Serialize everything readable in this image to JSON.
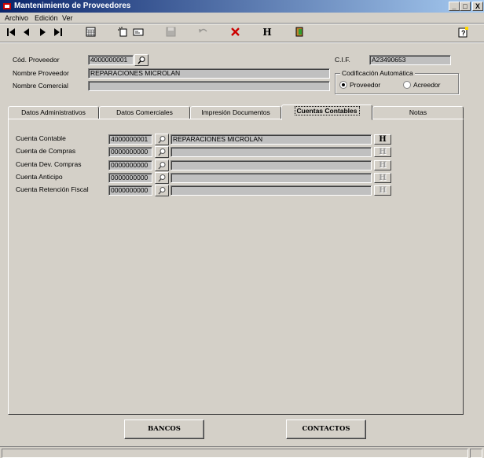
{
  "window": {
    "title": "Mantenimiento de Proveedores",
    "minimize": "_",
    "maximize": "□",
    "close": "X"
  },
  "menu": [
    "Archivo",
    "Edición",
    "Ver"
  ],
  "toolbar": {
    "icons": [
      "first-record-icon",
      "previous-record-icon",
      "next-record-icon",
      "last-record-icon",
      "calculator-icon",
      "new-record-icon",
      "id-card-icon",
      "save-icon",
      "undo-icon",
      "delete-icon",
      "history-icon",
      "exit-icon",
      "help-icon"
    ],
    "h_label": "H",
    "delete_color": "#cc0000"
  },
  "header": {
    "cod_label": "Cód. Proveedor",
    "cod_value": "4000000001",
    "nombre_label": "Nombre Proveedor",
    "nombre_value": "REPARACIONES MICROLAN",
    "comercial_label": "Nombre Comercial",
    "comercial_value": "",
    "cif_label": "C.I.F.",
    "cif_value": "A23490653"
  },
  "codificacion": {
    "title": "Codificación Automática",
    "options": [
      "Proveedor",
      "Acreedor"
    ],
    "selected": "Proveedor"
  },
  "tabs": [
    "Datos Administrativos",
    "Datos Comerciales",
    "Impresión Documentos",
    "Cuentas Contables",
    "Notas"
  ],
  "active_tab": "Cuentas Contables",
  "cuentas": [
    {
      "label": "Cuenta Contable",
      "code": "4000000001",
      "name": "REPARACIONES MICROLAN",
      "h": "H",
      "h_enabled": true
    },
    {
      "label": "Cuenta de Compras",
      "code": "0000000000",
      "name": "",
      "h": "H",
      "h_enabled": false
    },
    {
      "label": "Cuenta Dev. Compras",
      "code": "0000000000",
      "name": "",
      "h": "H",
      "h_enabled": false
    },
    {
      "label": "Cuenta Anticipo",
      "code": "0000000000",
      "name": "",
      "h": "H",
      "h_enabled": false
    },
    {
      "label": "Cuenta Retención Fiscal",
      "code": "0000000000",
      "name": "",
      "h": "H",
      "h_enabled": false
    }
  ],
  "buttons": {
    "bancos": "BANCOS",
    "contactos": "CONTACTOS"
  }
}
